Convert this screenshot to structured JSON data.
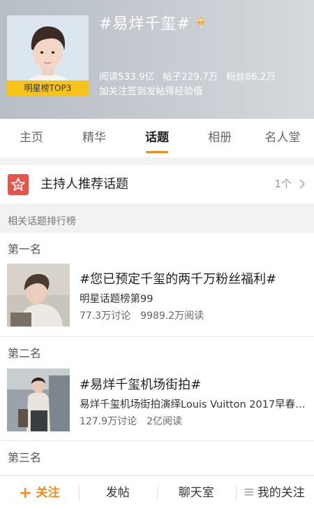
{
  "header": {
    "topic_title": "#易烊千玺#",
    "rank_tag": "明星榜TOP3",
    "stats": {
      "reads": "阅读533.9亿",
      "posts": "帖子229.7万",
      "fans": "粉丝86.2万"
    },
    "hint": "加关注签到发帖得经验值"
  },
  "tabs": [
    {
      "label": "主页"
    },
    {
      "label": "精华"
    },
    {
      "label": "话题"
    },
    {
      "label": "相册"
    },
    {
      "label": "名人堂"
    }
  ],
  "host_recommended": {
    "label": "主持人推荐话题",
    "count": "1个"
  },
  "section": {
    "title": "相关话题排行榜"
  },
  "rankings": [
    {
      "rank": "第一名",
      "title": "#您已预定千玺的两千万粉丝福利#",
      "subtitle": "明星话题榜第99",
      "discussions": "77.3万讨论",
      "reads": "9989.2万阅读"
    },
    {
      "rank": "第二名",
      "title": "#易烊千玺机场街拍#",
      "subtitle": "易烊千玺机场街拍演绎Louis Vuitton 2017早春…",
      "discussions": "127.9万讨论",
      "reads": "2亿阅读"
    },
    {
      "rank": "第三名"
    }
  ],
  "bottom_bar": {
    "follow": "关注",
    "post": "发帖",
    "chatroom": "聊天室",
    "my_follows": "我的关注"
  },
  "colors": {
    "accent": "#f28a1d",
    "rank_tag": "#f6c21c",
    "host_icon": "#e8534a"
  }
}
